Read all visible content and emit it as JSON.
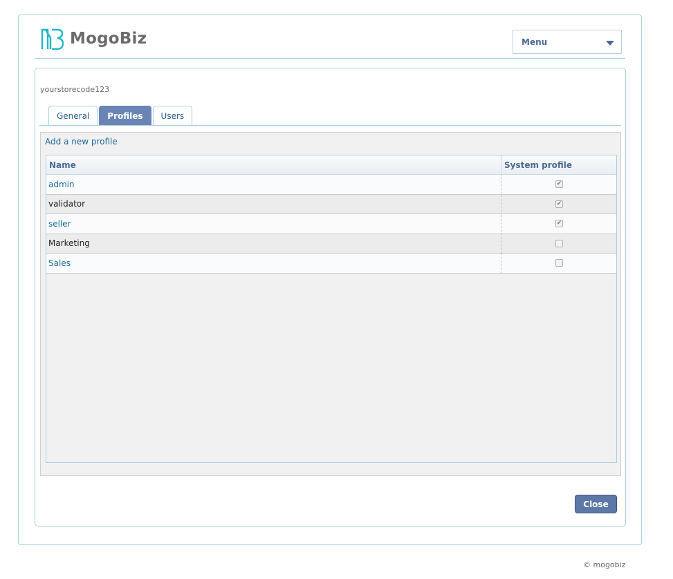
{
  "brand": {
    "name": "MogoBiz",
    "accent": "#1fb8c8"
  },
  "header": {
    "menu_label": "Menu"
  },
  "store": {
    "code": "yourstorecode123"
  },
  "tabs": [
    {
      "label": "General",
      "active": false
    },
    {
      "label": "Profiles",
      "active": true
    },
    {
      "label": "Users",
      "active": false
    }
  ],
  "profiles": {
    "add_link": "Add a new profile",
    "columns": {
      "name": "Name",
      "system_profile": "System profile"
    },
    "rows": [
      {
        "name": "admin",
        "system_profile": true
      },
      {
        "name": "validator",
        "system_profile": true
      },
      {
        "name": "seller",
        "system_profile": true
      },
      {
        "name": "Marketing",
        "system_profile": false
      },
      {
        "name": "Sales",
        "system_profile": false
      }
    ]
  },
  "actions": {
    "close_label": "Close"
  },
  "footer": {
    "copyright": "© mogobiz"
  }
}
